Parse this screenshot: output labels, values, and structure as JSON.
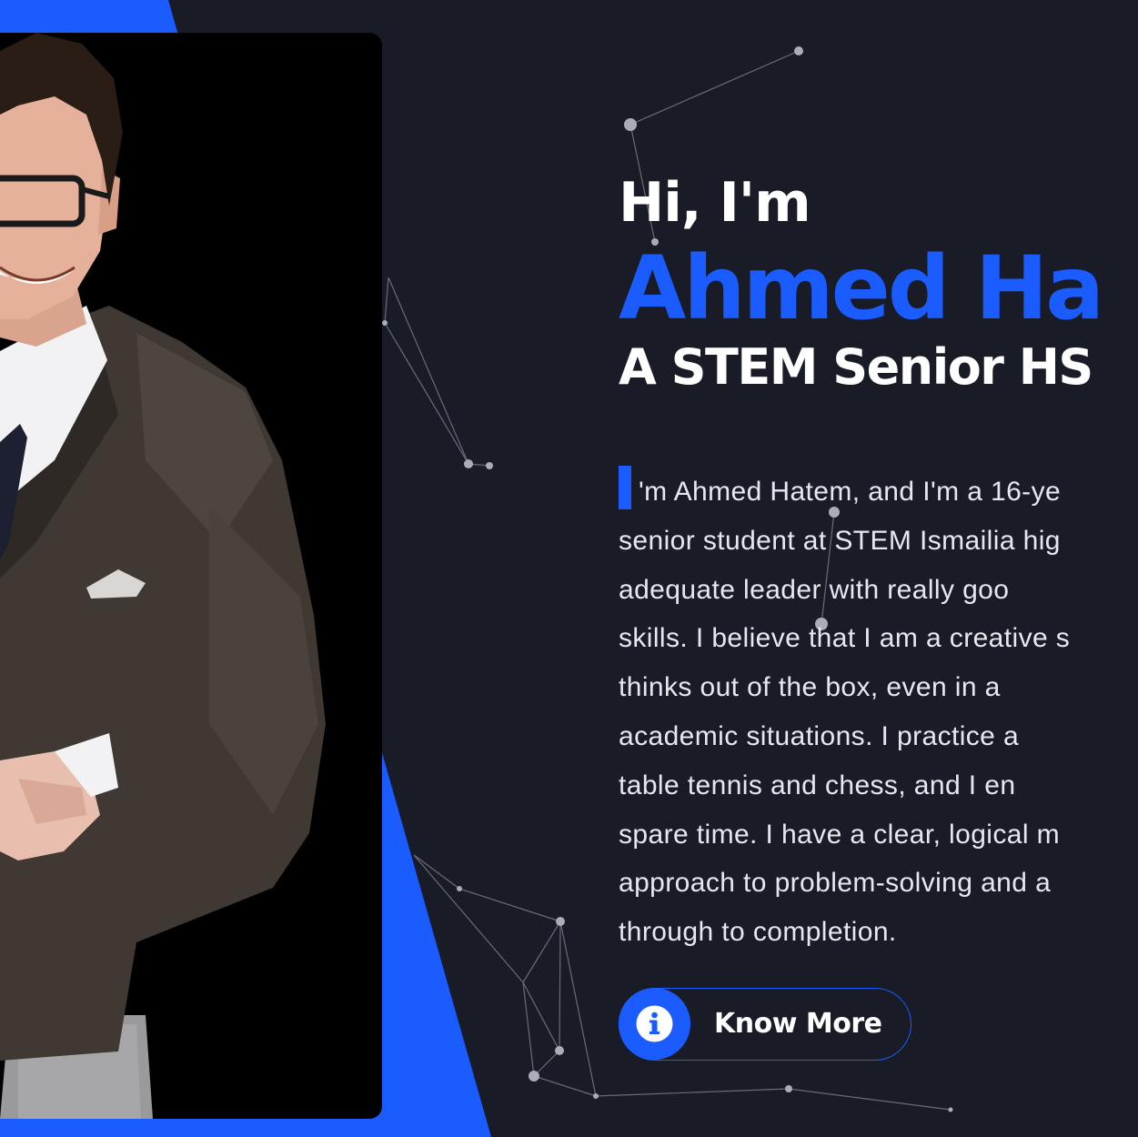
{
  "colors": {
    "background": "#191c27",
    "accent": "#1a5cff",
    "text": "#ffffff"
  },
  "hero": {
    "greeting": "Hi, I'm",
    "name": "Ahmed Ha",
    "role": "A STEM Senior HS"
  },
  "bio": {
    "dropcap_letter": "I",
    "lines": [
      "'m Ahmed Hatem, and I'm a 16-ye",
      "senior student at STEM Ismailia hig",
      "adequate leader with really goo",
      "skills. I believe that I am a creative s",
      "thinks out of the box, even in a",
      "academic situations. I practice a",
      "table tennis and chess, and I en",
      "spare time. I have a clear, logical m",
      "approach to problem-solving and a",
      "through to completion."
    ]
  },
  "cta": {
    "label": "Know More",
    "icon": "info-icon"
  },
  "photo": {
    "alt": "portrait-photo"
  }
}
